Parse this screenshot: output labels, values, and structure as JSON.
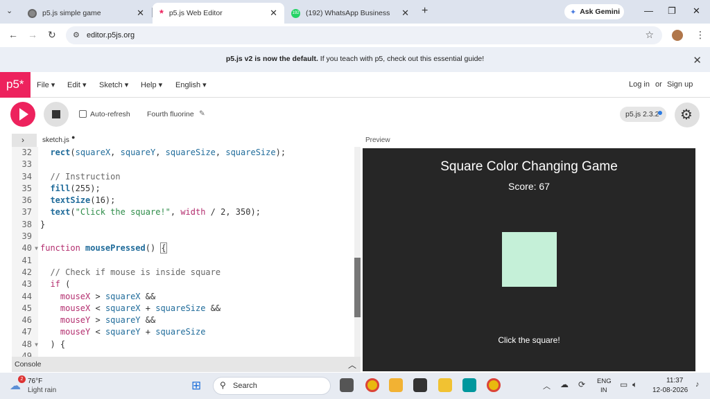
{
  "browser": {
    "tabs": [
      {
        "title": "p5.js simple game",
        "active": false
      },
      {
        "title": "p5.js Web Editor",
        "active": true
      },
      {
        "title": "(192) WhatsApp Business",
        "active": false
      }
    ],
    "whatsapp_badge": "192",
    "new_tab": "+",
    "ask_gemini": "Ask Gemini",
    "url": "editor.p5js.org"
  },
  "banner": {
    "bold": "p5.js v2 is now the default.",
    "text": " If you teach with p5, check out this essential guide!"
  },
  "menubar": {
    "logo": "p5*",
    "menus": [
      "File",
      "Edit",
      "Sketch",
      "Help",
      "English"
    ],
    "login": "Log in",
    "or": "or",
    "signup": "Sign up"
  },
  "toolbar": {
    "auto_refresh": "Auto-refresh",
    "sketch_name": "Fourth fluorine",
    "version": "p5.js 2.3.2"
  },
  "editor": {
    "file_name": "sketch.js",
    "line_numbers": [
      "32",
      "33",
      "34",
      "35",
      "36",
      "37",
      "38",
      "39",
      "40",
      "41",
      "42",
      "43",
      "44",
      "45",
      "46",
      "47",
      "48",
      "49"
    ],
    "console_label": "Console"
  },
  "preview": {
    "label": "Preview",
    "game_title": "Square Color Changing Game",
    "score": "Score: 67",
    "instruction": "Click the square!",
    "square_color": "#c5f0d8"
  },
  "taskbar": {
    "weather_badge": "2",
    "temperature": "76°F",
    "weather": "Light rain",
    "search": "Search",
    "lang_1": "ENG",
    "lang_2": "IN",
    "time": "11:37",
    "date": "12-08-2026"
  },
  "colors": {
    "p5_pink": "#ed225d",
    "canvas_bg": "#262626"
  }
}
